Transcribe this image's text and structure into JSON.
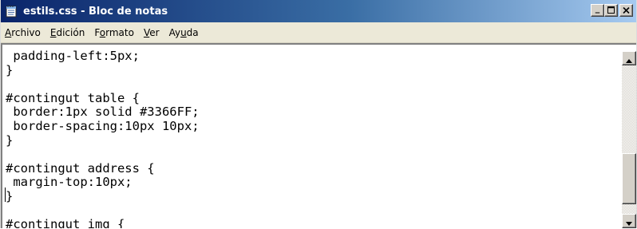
{
  "window": {
    "title": "estils.css - Bloc de notas",
    "icon": "notepad-icon",
    "controls": {
      "minimize": "_",
      "maximize": "□",
      "close": "×"
    }
  },
  "menu": {
    "items": [
      {
        "label": "Archivo",
        "mnemonic": "A"
      },
      {
        "label": "Edición",
        "mnemonic": "E"
      },
      {
        "label": "Formato",
        "mnemonic": "o"
      },
      {
        "label": "Ver",
        "mnemonic": "V"
      },
      {
        "label": "Ayuda",
        "mnemonic": "u"
      }
    ]
  },
  "editor": {
    "lines": [
      " padding-left:5px;",
      "}",
      "",
      "#contingut table {",
      " border:1px solid #3366FF;",
      " border-spacing:10px 10px;",
      "}",
      "",
      "#contingut address {",
      " margin-top:10px;",
      "}",
      "",
      "#contingut img {"
    ]
  },
  "scrollbar": {
    "up_icon": "scroll-up-arrow-icon",
    "down_icon": "scroll-down-arrow-icon"
  },
  "colors": {
    "titlebar_start": "#0a246a",
    "titlebar_end": "#a6caf0",
    "menubar_bg": "#ece9d8",
    "button_face": "#d4d0c8"
  }
}
